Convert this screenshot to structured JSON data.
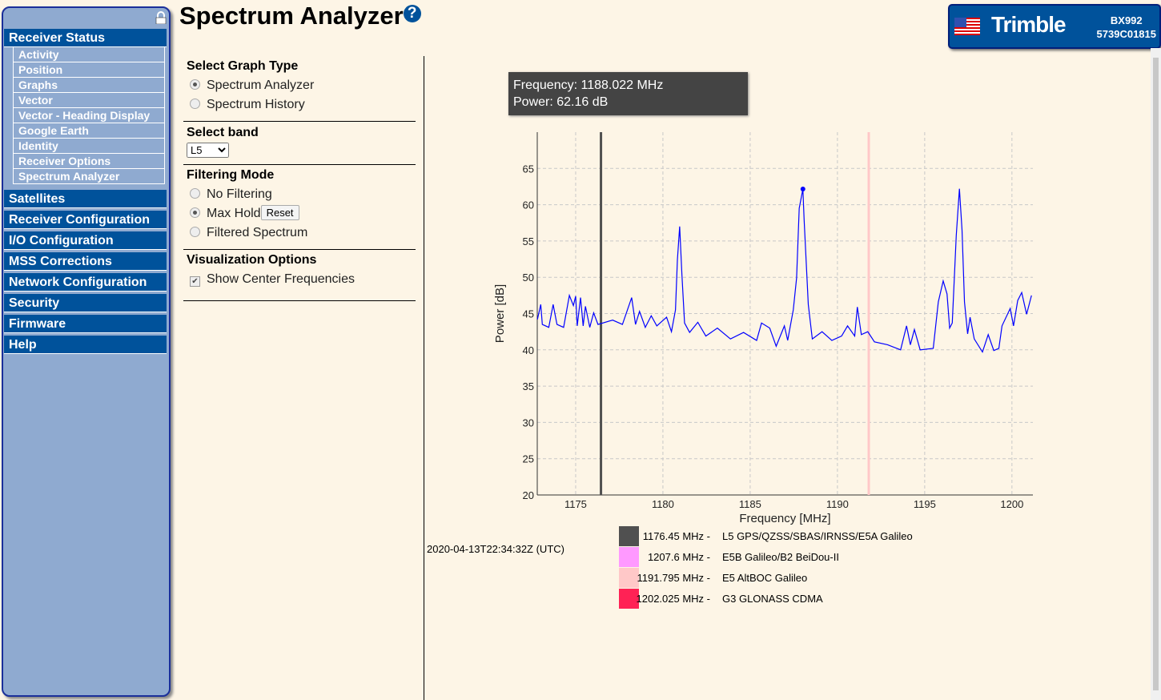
{
  "sidebar": {
    "sections": [
      {
        "label": "Receiver Status",
        "items": [
          "Activity",
          "Position",
          "Graphs",
          "Vector",
          "Vector - Heading Display",
          "Google Earth",
          "Identity",
          "Receiver Options",
          "Spectrum Analyzer"
        ]
      },
      {
        "label": "Satellites"
      },
      {
        "label": "Receiver Configuration"
      },
      {
        "label": "I/O Configuration"
      },
      {
        "label": "MSS Corrections"
      },
      {
        "label": "Network Configuration"
      },
      {
        "label": "Security"
      },
      {
        "label": "Firmware"
      },
      {
        "label": "Help"
      }
    ]
  },
  "header": {
    "title": "Spectrum Analyzer",
    "help_icon": "?"
  },
  "logo": {
    "brand": "Trimble",
    "model": "BX992",
    "serial": "5739C01815"
  },
  "controls": {
    "graph_type": {
      "label": "Select Graph Type",
      "options": [
        "Spectrum Analyzer",
        "Spectrum History"
      ],
      "selected": 0
    },
    "band": {
      "label": "Select band",
      "value": "L5"
    },
    "filtering": {
      "label": "Filtering Mode",
      "options": [
        "No Filtering",
        "Max Hold",
        "Filtered Spectrum"
      ],
      "selected": 1,
      "reset_label": "Reset"
    },
    "visualization": {
      "label": "Visualization Options",
      "show_center_label": "Show Center Frequencies",
      "show_center_checked": true
    }
  },
  "tooltip": {
    "frequency": "Frequency: 1188.022 MHz",
    "power": "Power: 62.16 dB"
  },
  "timestamp": "2020-04-13T22:34:32Z (UTC)",
  "chart_data": {
    "type": "line",
    "xlabel": "Frequency [MHz]",
    "ylabel": "Power [dB]",
    "xlim": [
      1172.8,
      1201.2
    ],
    "ylim": [
      20,
      70
    ],
    "xticks": [
      1175,
      1180,
      1185,
      1190,
      1195,
      1200
    ],
    "yticks": [
      20,
      25,
      30,
      35,
      40,
      45,
      50,
      55,
      60,
      65
    ],
    "grid": true,
    "line_color": "#0000ff",
    "highlight_point": [
      1188.022,
      62.16
    ],
    "center_lines": [
      {
        "x": 1176.45,
        "color": "#505050"
      },
      {
        "x": 1191.795,
        "color": "#ffc8c8"
      }
    ],
    "points": [
      [
        1172.81,
        44.2
      ],
      [
        1173.0,
        46.25
      ],
      [
        1173.09,
        43.5
      ],
      [
        1173.46,
        43.1
      ],
      [
        1173.71,
        46.25
      ],
      [
        1173.93,
        43.5
      ],
      [
        1174.31,
        43.1
      ],
      [
        1174.64,
        47.5
      ],
      [
        1174.87,
        46.1
      ],
      [
        1175.0,
        47.4
      ],
      [
        1175.09,
        43.3
      ],
      [
        1175.28,
        47.2
      ],
      [
        1175.43,
        43.3
      ],
      [
        1175.56,
        46.0
      ],
      [
        1175.81,
        43.1
      ],
      [
        1176.03,
        45.1
      ],
      [
        1176.28,
        43.5
      ],
      [
        1177.12,
        44.1
      ],
      [
        1177.68,
        43.5
      ],
      [
        1178.21,
        47.2
      ],
      [
        1178.43,
        43.5
      ],
      [
        1178.66,
        45.3
      ],
      [
        1178.99,
        43.1
      ],
      [
        1179.33,
        44.7
      ],
      [
        1179.65,
        43.3
      ],
      [
        1180.21,
        44.5
      ],
      [
        1180.49,
        42.5
      ],
      [
        1180.72,
        45.5
      ],
      [
        1180.83,
        52.4
      ],
      [
        1180.96,
        57.0
      ],
      [
        1181.09,
        50.3
      ],
      [
        1181.24,
        43.7
      ],
      [
        1181.53,
        42.4
      ],
      [
        1182.0,
        43.8
      ],
      [
        1182.46,
        41.9
      ],
      [
        1183.12,
        43.0
      ],
      [
        1183.87,
        41.5
      ],
      [
        1184.62,
        42.4
      ],
      [
        1185.37,
        41.3
      ],
      [
        1185.65,
        43.7
      ],
      [
        1186.12,
        43.0
      ],
      [
        1186.49,
        40.5
      ],
      [
        1186.96,
        43.3
      ],
      [
        1187.15,
        41.3
      ],
      [
        1187.47,
        45.5
      ],
      [
        1187.66,
        49.9
      ],
      [
        1187.81,
        59.5
      ],
      [
        1188.02,
        62.16
      ],
      [
        1188.09,
        58.0
      ],
      [
        1188.33,
        46.25
      ],
      [
        1188.56,
        41.5
      ],
      [
        1189.12,
        42.5
      ],
      [
        1189.68,
        41.3
      ],
      [
        1190.24,
        41.9
      ],
      [
        1190.58,
        43.3
      ],
      [
        1190.99,
        41.9
      ],
      [
        1191.14,
        45.9
      ],
      [
        1191.37,
        42.1
      ],
      [
        1191.74,
        42.5
      ],
      [
        1192.12,
        41.1
      ],
      [
        1192.87,
        40.7
      ],
      [
        1193.62,
        40.0
      ],
      [
        1193.96,
        43.3
      ],
      [
        1194.18,
        40.7
      ],
      [
        1194.41,
        42.8
      ],
      [
        1194.74,
        40.0
      ],
      [
        1195.49,
        40.2
      ],
      [
        1195.78,
        46.6
      ],
      [
        1196.06,
        49.5
      ],
      [
        1196.28,
        47.7
      ],
      [
        1196.43,
        43.0
      ],
      [
        1196.58,
        43.7
      ],
      [
        1196.81,
        55.8
      ],
      [
        1196.99,
        62.2
      ],
      [
        1197.14,
        56.5
      ],
      [
        1197.28,
        46.6
      ],
      [
        1197.46,
        42.2
      ],
      [
        1197.6,
        44.5
      ],
      [
        1197.84,
        41.5
      ],
      [
        1198.31,
        39.7
      ],
      [
        1198.64,
        42.1
      ],
      [
        1198.96,
        39.9
      ],
      [
        1199.25,
        40.2
      ],
      [
        1199.43,
        43.3
      ],
      [
        1199.9,
        45.7
      ],
      [
        1200.09,
        43.3
      ],
      [
        1200.33,
        46.8
      ],
      [
        1200.56,
        47.9
      ],
      [
        1200.84,
        44.9
      ],
      [
        1201.12,
        47.5
      ]
    ]
  },
  "legend": [
    {
      "freq": "1176.45 MHz -",
      "name": "L5 GPS/QZSS/SBAS/IRNSS/E5A Galileo",
      "color": "#505050"
    },
    {
      "freq": "1207.6 MHz -",
      "name": "E5B Galileo/B2 BeiDou-II",
      "color": "#ff99ff"
    },
    {
      "freq": "1191.795 MHz -",
      "name": "E5 AltBOC Galileo",
      "color": "#ffc8c8"
    },
    {
      "freq": "1202.025 MHz -",
      "name": "G3 GLONASS CDMA",
      "color": "#ff2255"
    }
  ]
}
